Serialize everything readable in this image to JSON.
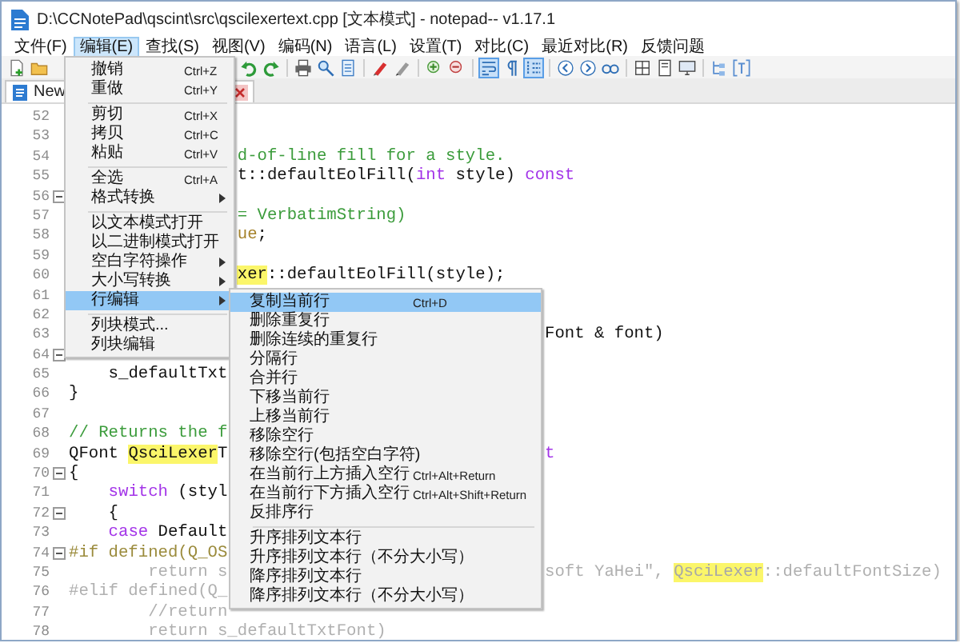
{
  "window": {
    "title": "D:\\CCNotePad\\qscint\\src\\qscilexertext.cpp [文本模式] - notepad-- v1.17.1"
  },
  "menubar": [
    {
      "label": "文件(F)",
      "selected": false
    },
    {
      "label": "编辑(E)",
      "selected": true
    },
    {
      "label": "查找(S)",
      "selected": false
    },
    {
      "label": "视图(V)",
      "selected": false
    },
    {
      "label": "编码(N)",
      "selected": false
    },
    {
      "label": "语言(L)",
      "selected": false
    },
    {
      "label": "设置(T)",
      "selected": false
    },
    {
      "label": "对比(C)",
      "selected": false
    },
    {
      "label": "最近对比(R)",
      "selected": false
    },
    {
      "label": "反馈问题",
      "selected": false
    }
  ],
  "toolbar": [
    {
      "on": false
    },
    {
      "on": false
    },
    {
      "on": false
    },
    {
      "on": false
    },
    {
      "on": false
    },
    {
      "on": false
    },
    {
      "on": false
    },
    {
      "on": false
    },
    {
      "on": false
    },
    {
      "on": false
    },
    {
      "on": false
    },
    {
      "on": true
    },
    {
      "on": false
    },
    {
      "on": true
    },
    {
      "on": false
    },
    {
      "on": false
    },
    {
      "on": false
    },
    {
      "on": false
    },
    {
      "on": false
    },
    {
      "on": false
    },
    {
      "on": false
    },
    {
      "on": false
    }
  ],
  "tab": {
    "label": "New"
  },
  "editor": {
    "lines": [
      {
        "number": "52",
        "fold": false
      },
      {
        "number": "53",
        "fold": false
      },
      {
        "number": "54",
        "fold": false,
        "parts": [
          [
            {
              "text": "                 d-of-line fill for a style.",
              "kind": "comment"
            }
          ]
        ]
      },
      {
        "number": "55",
        "fold": false,
        "parts": [
          [
            {
              "text": "                 t::defaultEolFill(",
              "kind": "plain"
            },
            {
              "text": "int",
              "kind": "keyword"
            },
            {
              "text": " style) ",
              "kind": "plain"
            },
            {
              "text": "const",
              "kind": "keyword"
            }
          ]
        ]
      },
      {
        "number": "56",
        "fold": true
      },
      {
        "number": "57",
        "fold": false,
        "parts": [
          [
            {
              "text": "                 = VerbatimString)",
              "kind": "constant"
            }
          ]
        ]
      },
      {
        "number": "58",
        "fold": false,
        "parts": [
          [
            {
              "text": "                 ue",
              "kind": "literal"
            },
            {
              "text": ";",
              "kind": "plain"
            }
          ]
        ]
      },
      {
        "number": "59",
        "fold": false
      },
      {
        "number": "60",
        "fold": false,
        "parts": [
          [
            {
              "text": "                 xer",
              "kind": "match"
            },
            {
              "text": "::defaultEolFill(style);",
              "kind": "plain"
            }
          ]
        ]
      },
      {
        "number": "61",
        "fold": false
      },
      {
        "number": "62",
        "fold": false
      },
      {
        "number": "63",
        "fold": false,
        "parts": [
          [
            {
              "text": "                                                Font & font)",
              "kind": "plain"
            }
          ]
        ]
      },
      {
        "number": "64",
        "fold": true
      },
      {
        "number": "65",
        "fold": false,
        "parts": [
          [
            {
              "text": "    s_defaultTxt",
              "kind": "plain"
            }
          ]
        ]
      },
      {
        "number": "66",
        "fold": false,
        "parts": [
          [
            {
              "text": "}",
              "kind": "plain"
            }
          ]
        ]
      },
      {
        "number": "67",
        "fold": false
      },
      {
        "number": "68",
        "fold": false,
        "parts": [
          [
            {
              "text": "// Returns the f",
              "kind": "comment"
            }
          ]
        ]
      },
      {
        "number": "69",
        "fold": false,
        "parts": [
          [
            {
              "text": "QFont ",
              "kind": "plain"
            },
            {
              "text": "QsciLexer",
              "kind": "match"
            },
            {
              "text": "T",
              "kind": "plain"
            }
          ],
          [
            {
              "text": "                                t",
              "kind": "keyword"
            }
          ]
        ]
      },
      {
        "number": "70",
        "fold": true,
        "parts": [
          [
            {
              "text": "{",
              "kind": "plain"
            }
          ]
        ]
      },
      {
        "number": "71",
        "fold": false,
        "parts": [
          [
            {
              "text": "    switch",
              "kind": "keyword"
            },
            {
              "text": " (styl",
              "kind": "plain"
            }
          ]
        ]
      },
      {
        "number": "72",
        "fold": true,
        "parts": [
          [
            {
              "text": "    {",
              "kind": "plain"
            }
          ]
        ]
      },
      {
        "number": "73",
        "fold": false,
        "parts": [
          [
            {
              "text": "    case",
              "kind": "keyword"
            },
            {
              "text": " Default",
              "kind": "plain"
            }
          ]
        ]
      },
      {
        "number": "74",
        "fold": true,
        "parts": [
          [
            {
              "text": "#if defined(Q_OS",
              "kind": "preproc"
            }
          ]
        ]
      },
      {
        "number": "75",
        "fold": false,
        "parts": [
          [
            {
              "text": "        return s",
              "kind": "inactive"
            }
          ],
          [
            {
              "text": "                                soft YaHei\", ",
              "kind": "inactive"
            },
            {
              "text": "QsciLexer",
              "kind": "match_inactive"
            },
            {
              "text": "::defaultFontSize)",
              "kind": "inactive"
            }
          ]
        ]
      },
      {
        "number": "76",
        "fold": false,
        "parts": [
          [
            {
              "text": "#elif defined(Q_",
              "kind": "inactive"
            }
          ]
        ]
      },
      {
        "number": "77",
        "fold": false,
        "parts": [
          [
            {
              "text": "        //return",
              "kind": "inactive"
            }
          ]
        ]
      },
      {
        "number": "78",
        "fold": false,
        "parts": [
          [
            {
              "text": "        return s_defaultTxtFont)",
              "kind": "inactive"
            }
          ]
        ]
      }
    ]
  },
  "edit_menu": {
    "groups": [
      [
        {
          "label": "撤销",
          "shortcut": "Ctrl+Z",
          "submenu": false,
          "selected": false
        },
        {
          "label": "重做",
          "shortcut": "Ctrl+Y",
          "submenu": false,
          "selected": false
        }
      ],
      [
        {
          "label": "剪切",
          "shortcut": "Ctrl+X",
          "submenu": false,
          "selected": false
        },
        {
          "label": "拷贝",
          "shortcut": "Ctrl+C",
          "submenu": false,
          "selected": false
        },
        {
          "label": "粘贴",
          "shortcut": "Ctrl+V",
          "submenu": false,
          "selected": false
        }
      ],
      [
        {
          "label": "全选",
          "shortcut": "Ctrl+A",
          "submenu": false,
          "selected": false
        },
        {
          "label": "格式转换",
          "submenu": true,
          "selected": false
        }
      ],
      [
        {
          "label": "以文本模式打开",
          "submenu": false,
          "selected": false
        },
        {
          "label": "以二进制模式打开",
          "submenu": false,
          "selected": false
        },
        {
          "label": "空白字符操作",
          "submenu": true,
          "selected": false
        },
        {
          "label": "大小写转换",
          "submenu": true,
          "selected": false
        },
        {
          "label": "行编辑",
          "submenu": true,
          "selected": true
        }
      ],
      [
        {
          "label": "列块模式...",
          "submenu": false,
          "selected": false
        },
        {
          "label": "列块编辑",
          "submenu": false,
          "selected": false
        }
      ]
    ]
  },
  "line_edit_menu": {
    "groups": [
      [
        {
          "label": "复制当前行",
          "shortcut": "Ctrl+D",
          "selected": true
        },
        {
          "label": "删除重复行",
          "selected": false
        },
        {
          "label": "删除连续的重复行",
          "selected": false
        },
        {
          "label": "分隔行",
          "selected": false
        },
        {
          "label": "合并行",
          "selected": false
        },
        {
          "label": "下移当前行",
          "selected": false
        },
        {
          "label": "上移当前行",
          "selected": false
        },
        {
          "label": "移除空行",
          "selected": false
        },
        {
          "label": "移除空行(包括空白字符)",
          "selected": false
        },
        {
          "label": "在当前行上方插入空行",
          "shortcut": "Ctrl+Alt+Return",
          "selected": false
        },
        {
          "label": "在当前行下方插入空行",
          "shortcut": "Ctrl+Alt+Shift+Return",
          "selected": false
        },
        {
          "label": "反排序行",
          "selected": false
        }
      ],
      [
        {
          "label": "升序排列文本行",
          "selected": false
        },
        {
          "label": "升序排列文本行（不分大小写）",
          "selected": false
        },
        {
          "label": "降序排列文本行",
          "selected": false
        },
        {
          "label": "降序排列文本行（不分大小写）",
          "selected": false
        }
      ]
    ]
  }
}
